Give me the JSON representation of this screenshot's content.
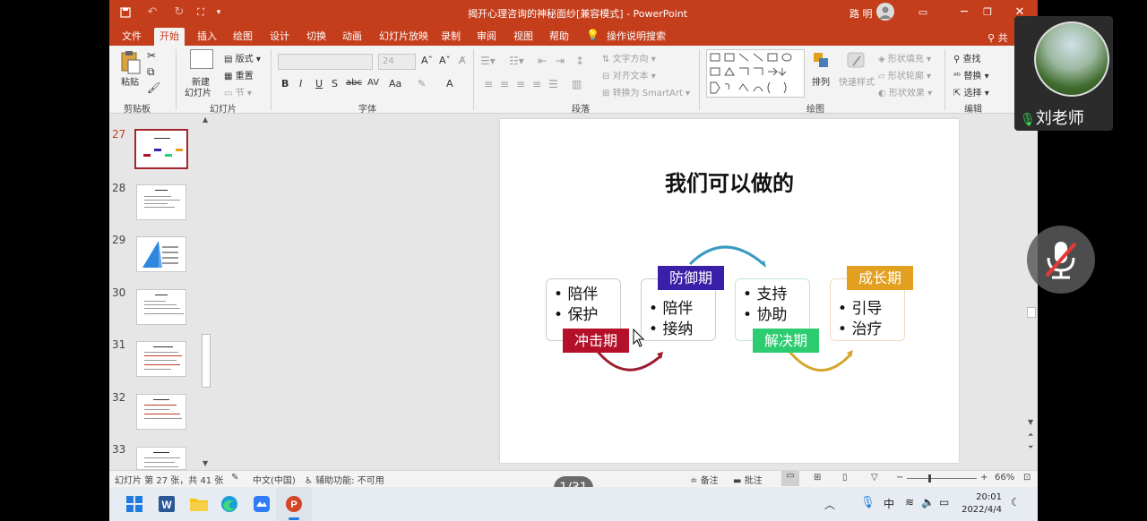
{
  "window": {
    "title": "揭开心理咨询的神秘面纱[兼容模式] - PowerPoint",
    "user_name": "路 明"
  },
  "ribbon_tabs": [
    "文件",
    "开始",
    "插入",
    "绘图",
    "设计",
    "切换",
    "动画",
    "幻灯片放映",
    "录制",
    "审阅",
    "视图",
    "帮助",
    "操作说明搜索"
  ],
  "ribbon_active_tab": "开始",
  "ribbon_share_fragment": "共",
  "ribbon": {
    "clipboard": {
      "paste": "粘贴",
      "group": "剪贴板"
    },
    "slides": {
      "new_slide_1": "新建",
      "new_slide_2": "幻灯片",
      "layout": "版式",
      "reset": "重置",
      "section": "节",
      "group": "幻灯片"
    },
    "font": {
      "size": "24",
      "bold": "B",
      "italic": "I",
      "underline": "U",
      "strike": "S",
      "spacing": "abc",
      "case": "Aa",
      "color": "A",
      "group": "字体"
    },
    "paragraph": {
      "text_direction": "文字方向",
      "align_text": "对齐文本",
      "smartart": "转换为 SmartArt",
      "group": "段落"
    },
    "drawing": {
      "arrange": "排列",
      "quick_styles": "快速样式",
      "fill": "形状填充",
      "outline": "形状轮廓",
      "effects": "形状效果",
      "group": "绘图"
    },
    "editing": {
      "find": "查找",
      "replace": "替换",
      "select": "选择",
      "group": "编辑"
    }
  },
  "thumbnails": [
    {
      "num": "27",
      "selected": true
    },
    {
      "num": "28",
      "selected": false
    },
    {
      "num": "29",
      "selected": false
    },
    {
      "num": "30",
      "selected": false
    },
    {
      "num": "31",
      "selected": false
    },
    {
      "num": "32",
      "selected": false
    },
    {
      "num": "33",
      "selected": false
    }
  ],
  "slide": {
    "title": "我们可以做的",
    "cards": [
      {
        "items": [
          "陪伴",
          "保护"
        ],
        "phase": "冲击期",
        "phase_color": "#b5102a"
      },
      {
        "items": [
          "陪伴",
          "接纳"
        ],
        "phase": "防御期",
        "phase_color": "#3a1fa8"
      },
      {
        "items": [
          "支持",
          "协助"
        ],
        "phase": "解决期",
        "phase_color": "#2ecc71"
      },
      {
        "items": [
          "引导",
          "治疗"
        ],
        "phase": "成长期",
        "phase_color": "#e3a020"
      }
    ]
  },
  "status": {
    "slide_info": "幻灯片 第 27 张，共 41 张",
    "language": "中文(中国)",
    "accessibility": "辅助功能: 不可用",
    "notes": "备注",
    "comments": "批注",
    "zoom": "66%"
  },
  "page_indicator": "1/31",
  "participant": {
    "name": "刘老师"
  },
  "taskbar": {
    "ime": "中",
    "time": "20:01",
    "date": "2022/4/4"
  }
}
